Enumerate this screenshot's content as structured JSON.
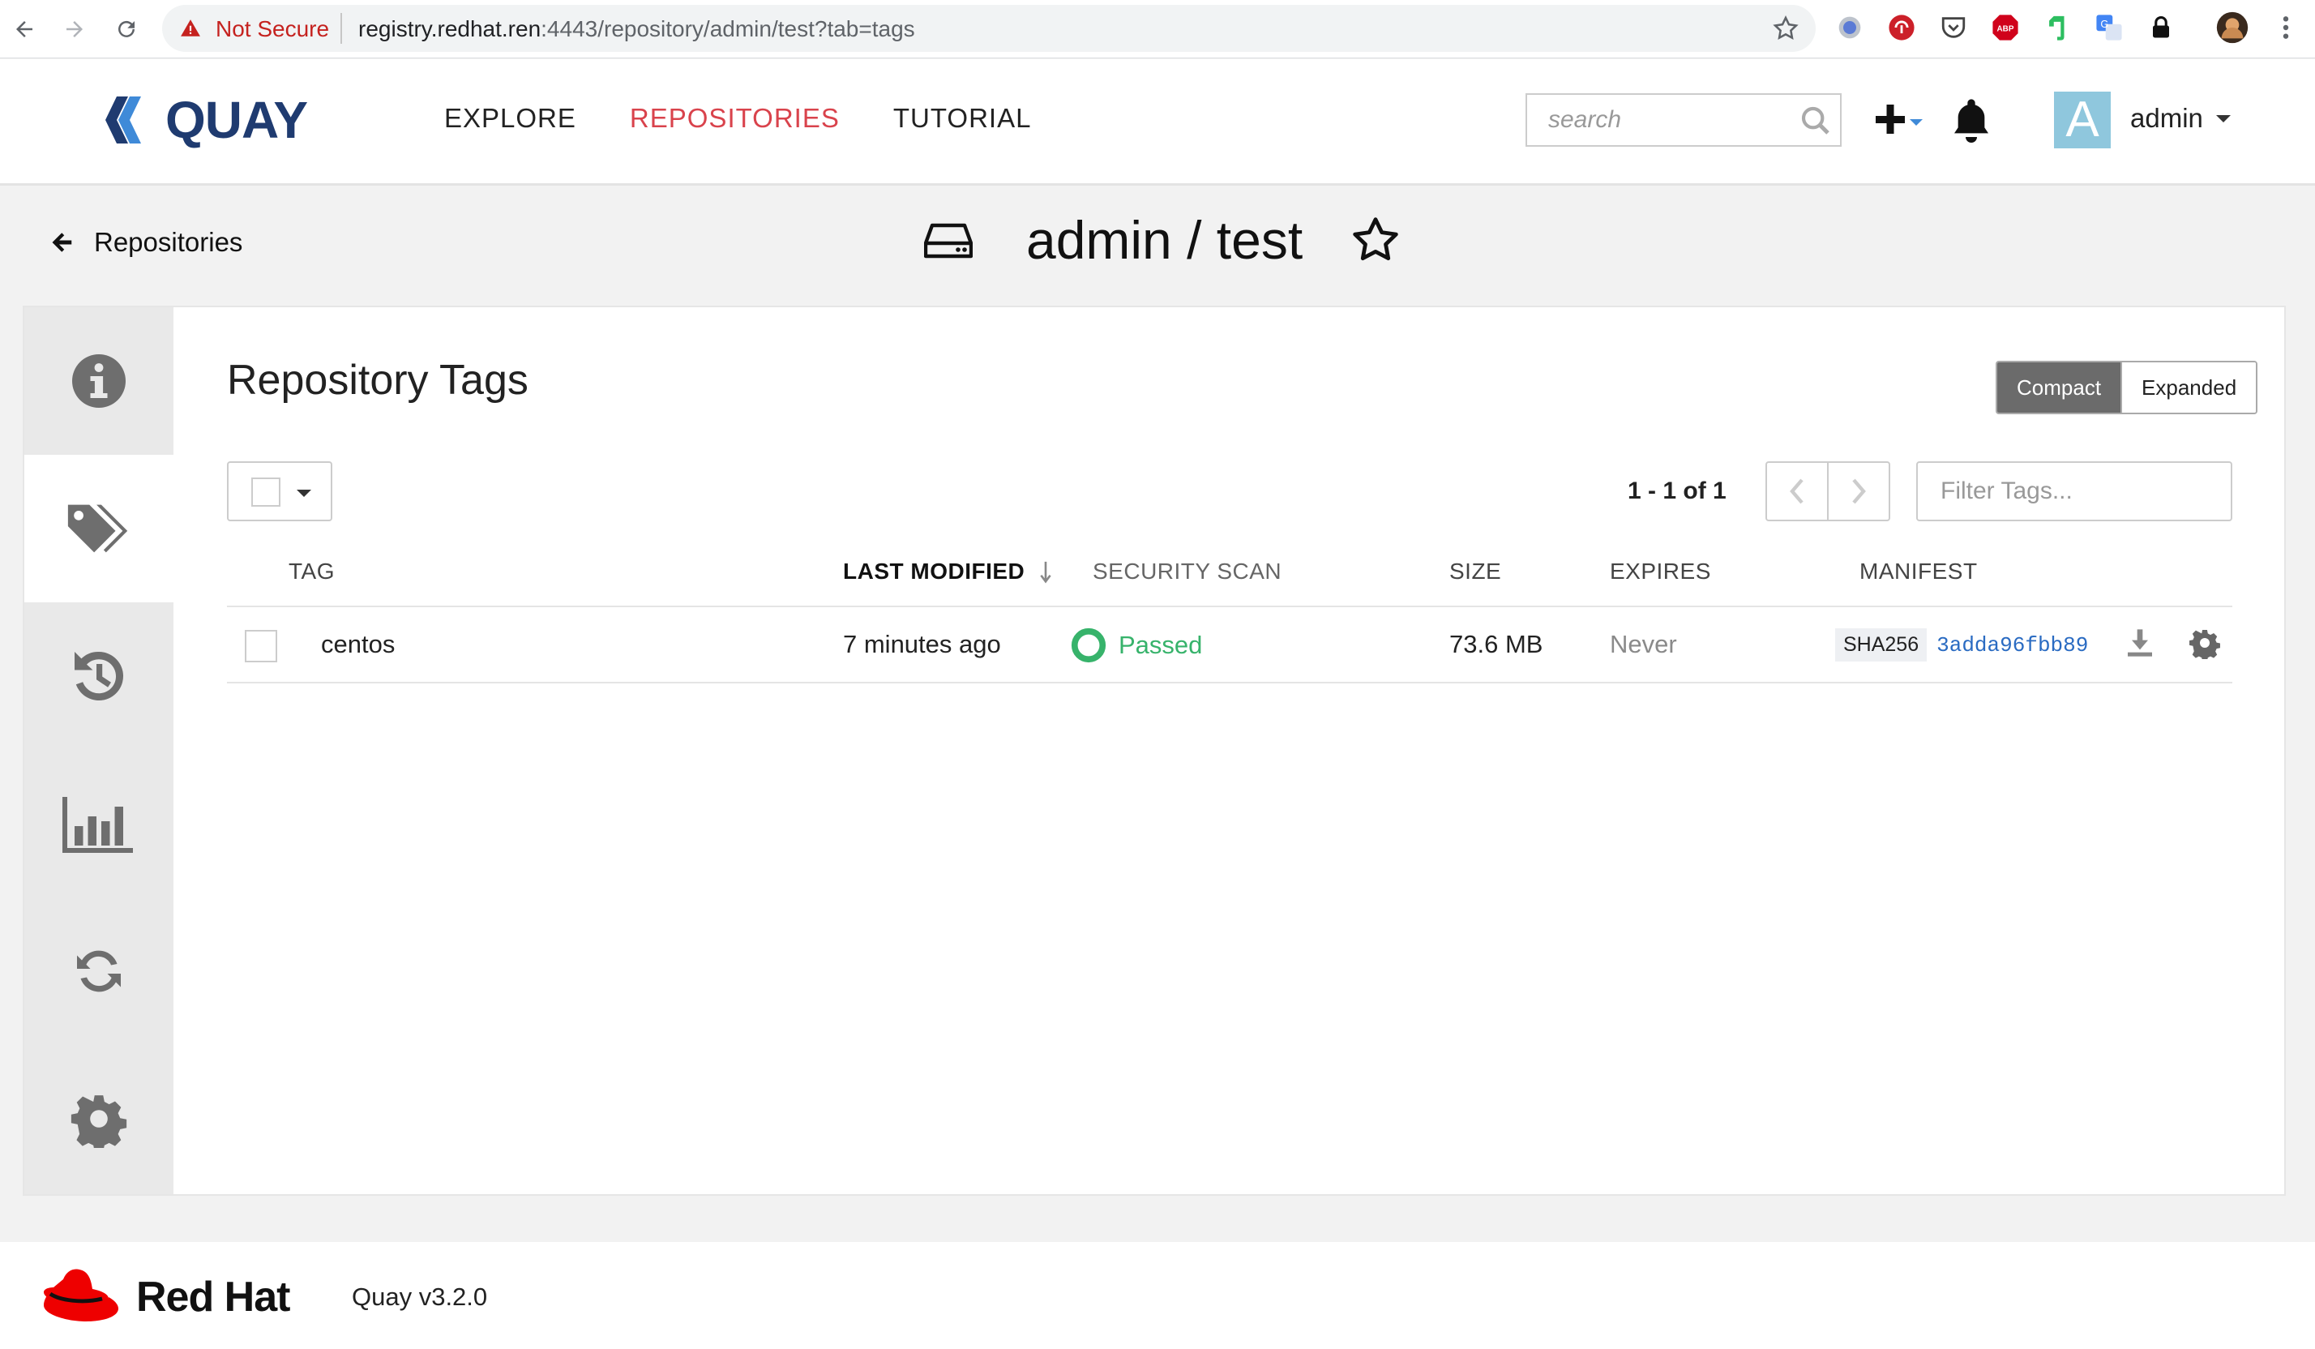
{
  "browser": {
    "security_label": "Not Secure",
    "url_host": "registry.redhat.ren",
    "url_path": ":4443/repository/admin/test?tab=tags",
    "extensions": [
      "record-icon",
      "lastpass-icon",
      "pocket-icon",
      "adblock-icon",
      "evernote-icon",
      "translate-icon",
      "lock-icon",
      "profile-avatar-icon",
      "menu-dots-icon"
    ],
    "extension_labels": {
      "adblock": "ABP"
    }
  },
  "header": {
    "logo_text": "QUAY",
    "nav": [
      {
        "label": "EXPLORE",
        "active": false
      },
      {
        "label": "REPOSITORIES",
        "active": true
      },
      {
        "label": "TUTORIAL",
        "active": false
      }
    ],
    "search_placeholder": "search",
    "avatar_letter": "A",
    "username": "admin"
  },
  "breadcrumb": {
    "back_label": "Repositories",
    "repo_title": "admin / test"
  },
  "sidebar": {
    "items": [
      {
        "name": "info",
        "icon": "info-icon",
        "active": false
      },
      {
        "name": "tags",
        "icon": "tags-icon",
        "active": true
      },
      {
        "name": "history",
        "icon": "history-icon",
        "active": false
      },
      {
        "name": "usage",
        "icon": "bar-chart-icon",
        "active": false
      },
      {
        "name": "mirroring",
        "icon": "refresh-icon",
        "active": false
      },
      {
        "name": "settings",
        "icon": "gear-icon",
        "active": false
      }
    ]
  },
  "tags": {
    "heading": "Repository Tags",
    "view_toggle": {
      "compact": "Compact",
      "expanded": "Expanded",
      "selected": "Compact"
    },
    "page_count": "1 - 1 of 1",
    "filter_placeholder": "Filter Tags...",
    "columns": {
      "tag": "TAG",
      "last_modified": "LAST MODIFIED",
      "security_scan": "SECURITY SCAN",
      "size": "SIZE",
      "expires": "EXPIRES",
      "manifest": "MANIFEST"
    },
    "sorted_by": "last_modified",
    "rows": [
      {
        "tag": "centos",
        "last_modified": "7 minutes ago",
        "security_scan": "Passed",
        "size": "73.6 MB",
        "expires": "Never",
        "manifest_algo": "SHA256",
        "manifest_digest": "3adda96fbb89"
      }
    ]
  },
  "footer": {
    "brand": "Red Hat",
    "version": "Quay v3.2.0"
  },
  "colors": {
    "accent_red": "#d9434c",
    "passed_green": "#37b36b",
    "digest_blue": "#2a6bc2",
    "quay_navy": "#1f3b70"
  }
}
